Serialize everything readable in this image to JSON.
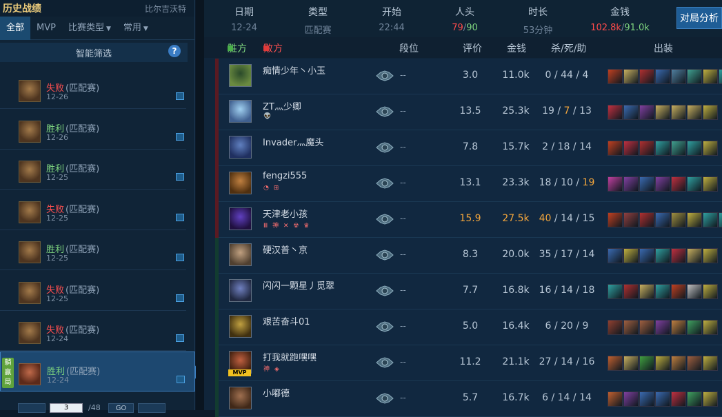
{
  "left": {
    "title": "历史战绩",
    "player": "比尔吉沃特",
    "tabs": [
      {
        "label": "全部",
        "caret": false
      },
      {
        "label": "MVP",
        "caret": false
      },
      {
        "label": "比赛类型",
        "caret": true
      },
      {
        "label": "常用",
        "caret": true
      }
    ],
    "filter_label": "智能筛选",
    "filter_help": "?",
    "caret_glyph": "▼",
    "matches": [
      {
        "result": "失败",
        "mode": "(匹配赛)",
        "date": "12-26",
        "win": false
      },
      {
        "result": "胜利",
        "mode": "(匹配赛)",
        "date": "12-26",
        "win": true
      },
      {
        "result": "胜利",
        "mode": "(匹配赛)",
        "date": "12-25",
        "win": true
      },
      {
        "result": "失败",
        "mode": "(匹配赛)",
        "date": "12-25",
        "win": false
      },
      {
        "result": "胜利",
        "mode": "(匹配赛)",
        "date": "12-25",
        "win": true
      },
      {
        "result": "失败",
        "mode": "(匹配赛)",
        "date": "12-25",
        "win": false
      },
      {
        "result": "失败",
        "mode": "(匹配赛)",
        "date": "12-24",
        "win": false
      },
      {
        "result": "胜利",
        "mode": "(匹配赛)",
        "date": "12-24",
        "win": true,
        "selected": true,
        "badge": "躺赢局"
      }
    ],
    "pager": {
      "page": "3",
      "total": "/48",
      "go": "GO"
    }
  },
  "summary": {
    "date_label": "日期",
    "date": "12-24",
    "type_label": "类型",
    "type": "匹配赛",
    "start_label": "开始",
    "start": "22:44",
    "kills_label": "人头",
    "kills_a": "79",
    "kills_sep": "/",
    "kills_b": "90",
    "duration_label": "时长",
    "duration": "53分钟",
    "gold_label": "金钱",
    "gold_a": "102.8k",
    "gold_sep": "/",
    "gold_b": "91.0k",
    "analyze": "对局分析"
  },
  "table": {
    "win_side": "胜方",
    "lose_side": "败方",
    "rank": "段位",
    "score": "评价",
    "gold": "金钱",
    "kda": "杀/死/助",
    "items": "出装"
  },
  "colors": {
    "win": "#7fd67f",
    "lose": "#ff5050",
    "highlight": "#f2a53c",
    "win_bar": "#5a1a22",
    "lose_bar": "#123c30"
  },
  "players": [
    {
      "name": "痴情少年丶小玉",
      "badges": "",
      "rank": "--",
      "score": "3.0",
      "gold": "11.0k",
      "k": "0",
      "d": "44",
      "a": "4",
      "side": "win",
      "hero": [
        "#2a4a2a",
        "#6a8a40"
      ],
      "items": [
        "#c04020",
        "#c8b060",
        "#b03030",
        "#3a6ab0",
        "#5080a0",
        "#40a090",
        "#c0b040",
        "#30a0a0"
      ]
    },
    {
      "name": "ZT灬少卿",
      "badges": "👽",
      "rank": "--",
      "score": "13.5",
      "gold": "25.3k",
      "k": "19",
      "d": "7",
      "a": "13",
      "dh": true,
      "side": "win",
      "hero": [
        "#a0d0f0",
        "#406090"
      ],
      "items": [
        "#c03040",
        "#3a6ab0",
        "#8040a0",
        "#c8b060",
        "#c8b060",
        "#c8b060",
        "#c0b040"
      ]
    },
    {
      "name": "Invader灬魔头",
      "badges": "",
      "rank": "--",
      "score": "7.8",
      "gold": "15.7k",
      "k": "2",
      "d": "18",
      "a": "14",
      "side": "win",
      "hero": [
        "#6080c0",
        "#203060"
      ],
      "items": [
        "#c04020",
        "#c03040",
        "#b03030",
        "#30a0a0",
        "#40a090",
        "#30a0a0",
        "#c0b040"
      ]
    },
    {
      "name": "fengzi555",
      "badges": "◔ ⊞",
      "rank": "--",
      "score": "13.1",
      "gold": "23.3k",
      "k": "18",
      "d": "10",
      "a": "19",
      "ah": true,
      "side": "win",
      "hero": [
        "#c08040",
        "#503010"
      ],
      "items": [
        "#c040a0",
        "#8040a0",
        "#3a6ab0",
        "#8040a0",
        "#c03040",
        "#30a0a0",
        "#c0b040"
      ]
    },
    {
      "name": "天津老小孩",
      "badges": "Ⅲ 神 ✕ ☢ ♛",
      "rank": "--",
      "score": "15.9",
      "gold": "27.5k",
      "k": "40",
      "d": "14",
      "a": "15",
      "sh": true,
      "side": "win",
      "hero": [
        "#6040c0",
        "#201040"
      ],
      "items": [
        "#c04020",
        "#904040",
        "#b03030",
        "#3a6ab0",
        "#a09040",
        "#c0b040",
        "#30a0a0",
        "#30a0a0"
      ]
    },
    {
      "name": "硬汉普丶京",
      "badges": "",
      "rank": "--",
      "score": "8.3",
      "gold": "20.0k",
      "k": "35",
      "d": "17",
      "a": "14",
      "side": "lose",
      "hero": [
        "#c0a080",
        "#504030"
      ],
      "items": [
        "#3a6ab0",
        "#c0b040",
        "#3a6ab0",
        "#30a0a0",
        "#c03040",
        "#c8b060",
        "#c0b040"
      ]
    },
    {
      "name": "闪闪一颗星丿觅翠",
      "badges": "",
      "rank": "--",
      "score": "7.7",
      "gold": "16.8k",
      "k": "16",
      "d": "14",
      "a": "18",
      "side": "lose",
      "hero": [
        "#7080c0",
        "#202840"
      ],
      "items": [
        "#30a0a0",
        "#b03030",
        "#c8b060",
        "#30a0a0",
        "#c04020",
        "#c0c0c0",
        "#c0b040"
      ]
    },
    {
      "name": "艰苦奋斗01",
      "badges": "",
      "rank": "--",
      "score": "5.0",
      "gold": "16.4k",
      "k": "6",
      "d": "20",
      "a": "9",
      "side": "lose",
      "hero": [
        "#c0a040",
        "#403010"
      ],
      "items": [
        "#904030",
        "#a06040",
        "#a06040",
        "#8040a0",
        "#c08040",
        "#40a060",
        "#c0b040"
      ]
    },
    {
      "name": "打我就跑嘿嘿",
      "badges": "神 ◈",
      "rank": "--",
      "score": "11.2",
      "gold": "21.1k",
      "k": "27",
      "d": "14",
      "a": "16",
      "mvp": "MVP",
      "side": "lose",
      "hero": [
        "#c06040",
        "#402010"
      ],
      "items": [
        "#c06030",
        "#c8b060",
        "#40a040",
        "#c0b040",
        "#c08040",
        "#a06040",
        "#c0b040"
      ]
    },
    {
      "name": "小嘟德",
      "badges": "",
      "rank": "--",
      "score": "5.7",
      "gold": "16.7k",
      "k": "6",
      "d": "14",
      "a": "14",
      "side": "lose",
      "hero": [
        "#a07050",
        "#402818"
      ],
      "items": [
        "#c06030",
        "#8040a0",
        "#3a6ab0",
        "#3a6ab0",
        "#c03040",
        "#40a060",
        "#c0b040"
      ]
    }
  ]
}
